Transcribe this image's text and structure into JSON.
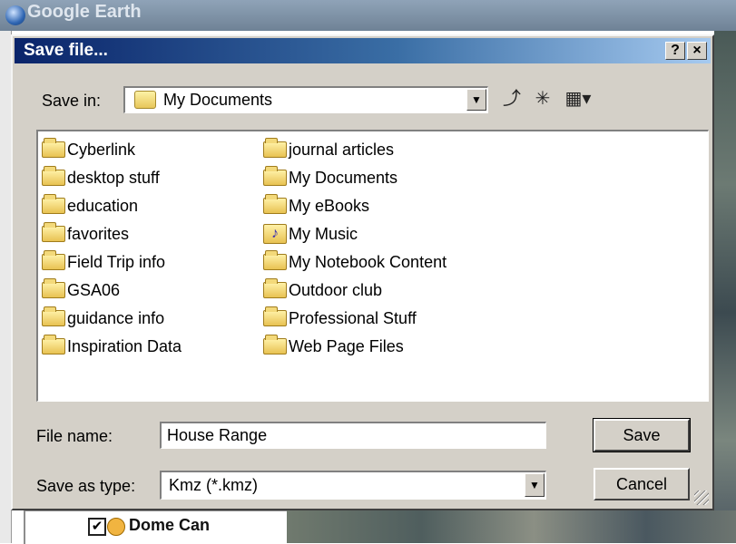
{
  "background_app": {
    "title": "Google Earth",
    "places_item_label": "Dome Can",
    "places_item_checked": true
  },
  "dialog": {
    "title": "Save file...",
    "help_label": "?",
    "close_label": "×",
    "save_in": {
      "label": "Save in:",
      "value": "My Documents"
    },
    "toolbar_icons": [
      "up-one-level-icon",
      "new-folder-icon",
      "views-menu-icon"
    ],
    "files_col1": [
      {
        "name": "Cyberlink",
        "icon": "folder-icon"
      },
      {
        "name": "desktop stuff",
        "icon": "folder-icon"
      },
      {
        "name": "education",
        "icon": "folder-icon"
      },
      {
        "name": "favorites",
        "icon": "folder-icon"
      },
      {
        "name": "Field Trip info",
        "icon": "folder-icon"
      },
      {
        "name": "GSA06",
        "icon": "folder-icon"
      },
      {
        "name": "guidance info",
        "icon": "folder-icon"
      },
      {
        "name": "Inspiration Data",
        "icon": "folder-icon"
      }
    ],
    "files_col2": [
      {
        "name": "journal articles",
        "icon": "folder-icon"
      },
      {
        "name": "My Documents",
        "icon": "folder-icon"
      },
      {
        "name": "My eBooks",
        "icon": "folder-icon"
      },
      {
        "name": "My Music",
        "icon": "music-folder-icon"
      },
      {
        "name": "My Notebook Content",
        "icon": "folder-icon"
      },
      {
        "name": "Outdoor club",
        "icon": "folder-icon"
      },
      {
        "name": "Professional Stuff",
        "icon": "folder-icon"
      },
      {
        "name": "Web Page Files",
        "icon": "folder-icon"
      }
    ],
    "file_name": {
      "label": "File name:",
      "value": "House Range"
    },
    "save_as_type": {
      "label": "Save as type:",
      "value": "Kmz (*.kmz)"
    },
    "save_button": "Save",
    "cancel_button": "Cancel"
  },
  "colors": {
    "titlebar_start": "#0a246a",
    "titlebar_end": "#a6caf0",
    "dialog_face": "#d4d0c8",
    "folder_yellow": "#e8c252"
  }
}
